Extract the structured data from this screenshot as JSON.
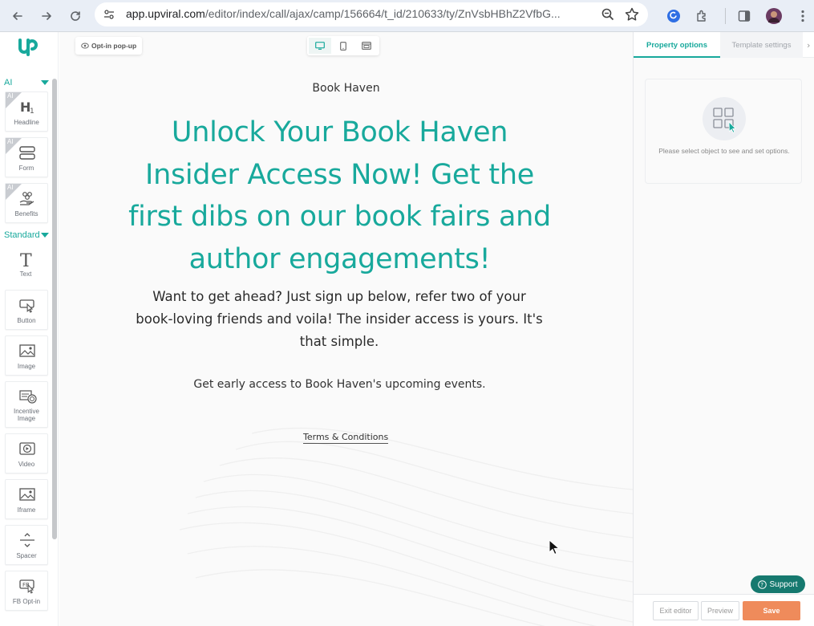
{
  "browser": {
    "url_main": "app.upviral.com",
    "url_path": "/editor/index/call/ajax/camp/156664/t_id/210633/ty/ZnVsbHBhZ2VfbG..."
  },
  "left_panel": {
    "ai_section_label": "AI",
    "standard_section_label": "Standard",
    "ai_badge": "AI",
    "ai_tools": [
      {
        "label": "Headline",
        "icon": "headline-icon"
      },
      {
        "label": "Form",
        "icon": "form-icon"
      },
      {
        "label": "Benefits",
        "icon": "benefits-icon"
      }
    ],
    "standard_tools": [
      {
        "label": "Text",
        "icon": "text-icon"
      },
      {
        "label": "Button",
        "icon": "button-icon"
      },
      {
        "label": "Image",
        "icon": "image-icon"
      },
      {
        "label": "Incentive Image",
        "icon": "incentive-image-icon"
      },
      {
        "label": "Video",
        "icon": "video-icon"
      },
      {
        "label": "Iframe",
        "icon": "iframe-icon"
      },
      {
        "label": "Spacer",
        "icon": "spacer-icon"
      },
      {
        "label": "FB Opt-in",
        "icon": "fb-optin-icon"
      }
    ]
  },
  "canvas": {
    "optin_badge": "Opt-in pop-up",
    "brand_name": "Book Haven",
    "headline": "Unlock Your Book Haven Insider Access Now! Get the first dibs on our book fairs and author engagements!",
    "subheadline": "Want to get ahead? Just sign up below, refer two of your book-loving friends and voila! The insider access is yours. It's that simple.",
    "description": "Get early access to Book Haven's upcoming events.",
    "terms_link": "Terms & Conditions"
  },
  "right_panel": {
    "tab_property": "Property options",
    "tab_template": "Template settings",
    "empty_message": "Please select object to see and set options.",
    "support_label": "Support",
    "exit_label": "Exit editor",
    "preview_label": "Preview",
    "save_label": "Save"
  },
  "colors": {
    "accent": "#18a99c",
    "save": "#ef8b5b",
    "support": "#16796f"
  }
}
